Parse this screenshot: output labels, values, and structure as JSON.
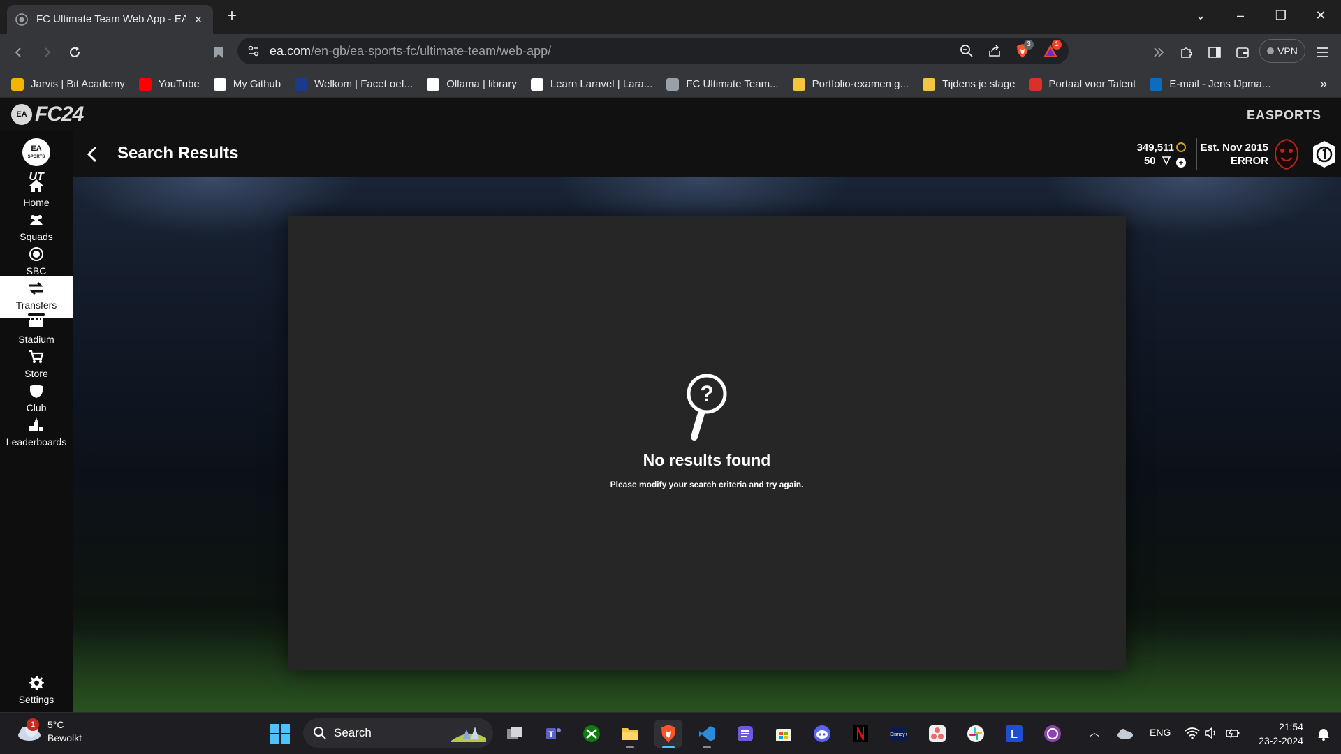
{
  "browser": {
    "tab_title": "FC Ultimate Team Web App - EA",
    "url_host": "ea.com",
    "url_path": "/en-gb/ea-sports-fc/ultimate-team/web-app/",
    "brave_badge": "3",
    "rewards_badge": "1",
    "vpn_label": "VPN"
  },
  "bookmarks": [
    {
      "label": "Jarvis | Bit Academy",
      "icon": "bit-academy-icon",
      "color": "#f5b400"
    },
    {
      "label": "YouTube",
      "icon": "youtube-icon",
      "color": "#ff0000"
    },
    {
      "label": "My Github",
      "icon": "github-icon",
      "color": "#ffffff"
    },
    {
      "label": "Welkom | Facet oef...",
      "icon": "facet-icon",
      "color": "#1b3b8a"
    },
    {
      "label": "Ollama | library",
      "icon": "ollama-icon",
      "color": "#ffffff"
    },
    {
      "label": "Learn Laravel | Lara...",
      "icon": "laracasts-icon",
      "color": "#ffffff"
    },
    {
      "label": "FC Ultimate Team...",
      "icon": "globe-icon",
      "color": "#9aa0a6"
    },
    {
      "label": "Portfolio-examen g...",
      "icon": "pen-icon",
      "color": "#f5c542"
    },
    {
      "label": "Tijdens je stage",
      "icon": "bulb-icon",
      "color": "#f5c542"
    },
    {
      "label": "Portaal voor Talent",
      "icon": "talent-icon",
      "color": "#d9302c"
    },
    {
      "label": "E-mail - Jens IJpma...",
      "icon": "outlook-icon",
      "color": "#0f6cbd"
    }
  ],
  "game": {
    "logo_text": "FC24",
    "ea_short": "EA",
    "brand": "EASPORTS",
    "ut_label": "UT"
  },
  "nav": [
    {
      "label": "Home",
      "icon": "home-icon",
      "active": false
    },
    {
      "label": "Squads",
      "icon": "squads-icon",
      "active": false
    },
    {
      "label": "SBC",
      "icon": "sbc-icon",
      "active": false
    },
    {
      "label": "Transfers",
      "icon": "transfers-icon",
      "active": true
    },
    {
      "label": "Stadium",
      "icon": "stadium-icon",
      "active": false
    },
    {
      "label": "Store",
      "icon": "store-icon",
      "active": false
    },
    {
      "label": "Club",
      "icon": "club-icon",
      "active": false
    },
    {
      "label": "Leaderboards",
      "icon": "leaderboards-icon",
      "active": false
    }
  ],
  "settings_label": "Settings",
  "header": {
    "title": "Search Results",
    "coins": "349,511",
    "points": "50",
    "est": "Est. Nov 2015",
    "club_name": "ERROR"
  },
  "empty_state": {
    "title": "No results found",
    "subtitle": "Please modify your search criteria and try again."
  },
  "taskbar": {
    "weather_temp": "5°C",
    "weather_desc": "Bewolkt",
    "weather_badge": "1",
    "search_placeholder": "Search",
    "language": "ENG",
    "time": "21:54",
    "date": "23-2-2024"
  },
  "colors": {
    "active_nav_bg": "#ffffff",
    "panel_bg": "#262626",
    "coin_gold": "#c9a227",
    "taskbar_accent": "#4cc2ff"
  }
}
